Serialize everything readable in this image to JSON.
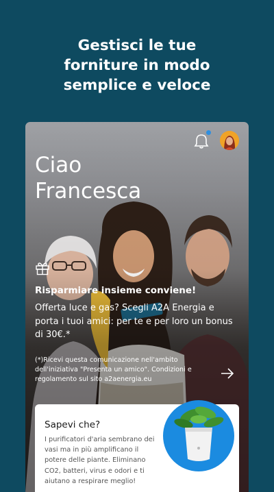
{
  "headline": {
    "line1": "Gestisci le tue",
    "line2": "forniture in modo",
    "line3": "semplice e veloce"
  },
  "app": {
    "greeting_line1": "Ciao",
    "greeting_line2": "Francesca",
    "notification_dot": true,
    "promo": {
      "title": "Risparmiare insieme conviene!",
      "body": "Offerta luce e gas? Scegli A2A Energia e porta i tuoi amici: per te e per loro un bonus di 30€.*",
      "note": "(*)Ricevi questa comunicazione nell'ambito dell'iniziativa \"Presenta un amico\". Condizioni e regolamento sul sito a2aenergia.eu"
    },
    "tip": {
      "title": "Sapevi che?",
      "body": "I purificatori d'aria sembrano dei vasi ma in più amplificano il potere delle piante. Eliminano CO2, batteri, virus e odori e ti aiutano a respirare meglio!"
    }
  },
  "colors": {
    "background": "#0e4a60",
    "accent_blue": "#1b8be0",
    "avatar_bg": "#f0a327"
  },
  "icons": [
    "bell-icon",
    "gift-icon",
    "arrow-right-icon",
    "avatar"
  ]
}
